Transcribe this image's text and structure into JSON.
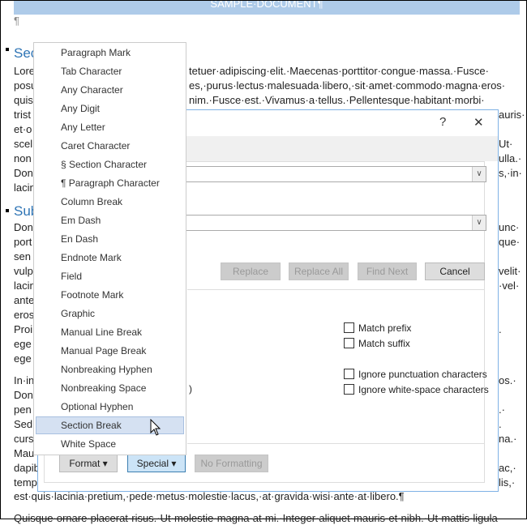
{
  "document": {
    "title_band": "SAMPLE·DOCUMENT¶",
    "empty_para": "¶",
    "heading1": "Sec",
    "heading2": "Sub",
    "lines": [
      {
        "l": "Lore",
        "r": "tetuer·adipiscing·elit.·Maecenas·porttitor·congue·massa.·Fusce·",
        "side": "mid"
      },
      {
        "l": "posu",
        "r": "es,·purus·lectus·malesuada·libero,·sit·amet·commodo·magna·eros·",
        "side": "mid"
      },
      {
        "l": "quis",
        "r": "nim.·Fusce·est.·Vivamus·a·tellus.·Pellentesque·habitant·morbi·",
        "side": "mid"
      },
      {
        "l": "trist",
        "r": "auris·"
      },
      {
        "l": "et·o",
        "r": ""
      },
      {
        "l": "scel",
        "r": "Ut·"
      },
      {
        "l": "non",
        "r": "ulla.·"
      },
      {
        "l": "Don",
        "r": "s,·in·"
      },
      {
        "l": "lacin",
        "r": ""
      }
    ],
    "lines2": [
      {
        "l": "Don",
        "r": "unc·"
      },
      {
        "l": "port",
        "r": "que·"
      },
      {
        "l": "sen",
        "r": ""
      },
      {
        "l": "vulp",
        "r": "velit·"
      },
      {
        "l": "lacin",
        "r": "·vel·"
      },
      {
        "l": "ante",
        "r": ""
      },
      {
        "l": "eros",
        "r": ""
      },
      {
        "l": "Proi",
        "r": "."
      },
      {
        "l": "ege",
        "r": ""
      },
      {
        "l": "ege",
        "r": ""
      }
    ],
    "lines3": [
      {
        "l": "In·in",
        "r": "os.·"
      },
      {
        "l": "Don",
        "r": ""
      },
      {
        "l": "pen",
        "r": ".·"
      },
      {
        "l": "Sed",
        "r": "."
      },
      {
        "l": "curs",
        "r": "na.·"
      },
      {
        "l": "Mau",
        "r": ""
      },
      {
        "l": "dapib",
        "r": "ac,·"
      },
      {
        "l": "temp",
        "r": "lis,·"
      }
    ],
    "last_line": "est·quis·lacinia·pretium,·pede·metus·molestie·lacus,·at·gravida·wisi·ante·at·libero.¶",
    "cut_line": "Quisque·ornare·placerat·risus.·Ut·molestie·magna·at·mi.·Integer·aliquet·mauris·et·nibh.·Ut·mattis·ligula"
  },
  "dialog": {
    "help": "?",
    "close": "✕",
    "language_fragment": ")",
    "buttons": {
      "replace": "Replace",
      "replace_all": "Replace All",
      "find_next": "Find Next",
      "cancel": "Cancel"
    },
    "checkboxes": [
      {
        "label": "Match prefix",
        "checked": false
      },
      {
        "label": "Match suffix",
        "checked": false
      },
      {
        "label": "Ignore punctuation characters",
        "checked": false
      },
      {
        "label": "Ignore white-space characters",
        "checked": false
      }
    ],
    "format": "Format ▾",
    "special": "Special ▾",
    "no_formatting": "No Formatting"
  },
  "special_menu": {
    "items": [
      "Paragraph Mark",
      "Tab Character",
      "Any Character",
      "Any Digit",
      "Any Letter",
      "Caret Character",
      "§ Section Character",
      "¶ Paragraph Character",
      "Column Break",
      "Em Dash",
      "En Dash",
      "Endnote Mark",
      "Field",
      "Footnote Mark",
      "Graphic",
      "Manual Line Break",
      "Manual Page Break",
      "Nonbreaking Hyphen",
      "Nonbreaking Space",
      "Optional Hyphen",
      "Section Break",
      "White Space"
    ],
    "highlighted": "Section Break"
  },
  "colors": {
    "accent": "#2e74b5",
    "band": "#aecbe9",
    "highlight": "#d5e1f2"
  }
}
